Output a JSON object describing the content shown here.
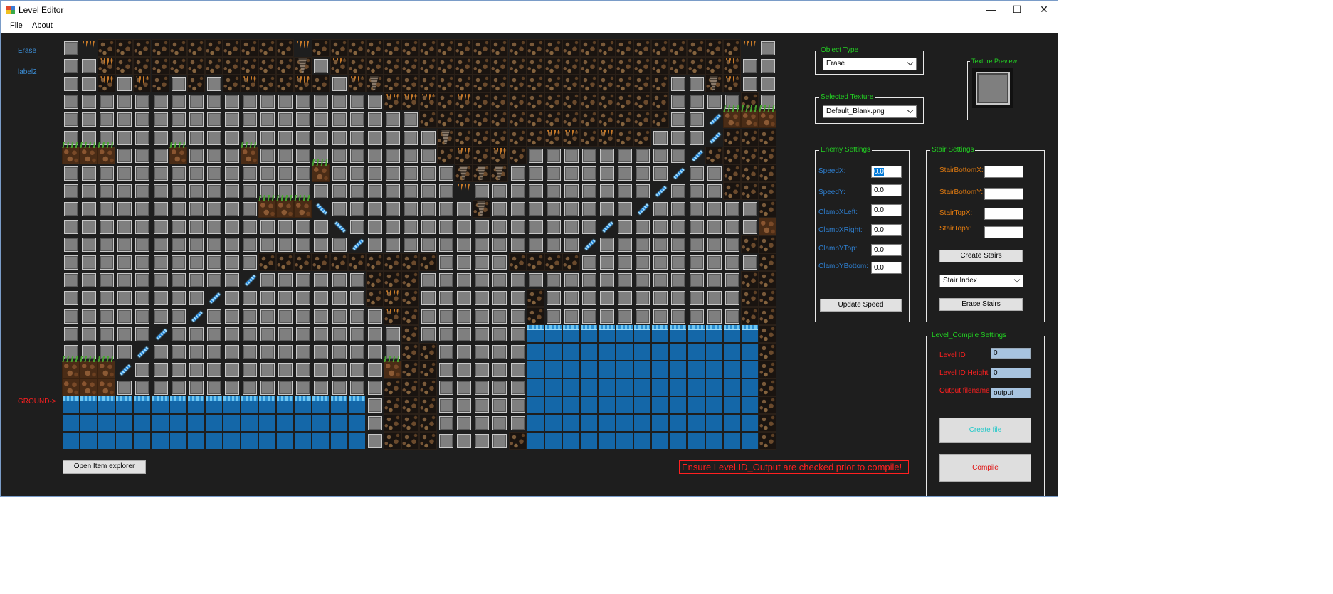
{
  "window": {
    "title": "Level Editor",
    "controls": {
      "minimize": "—",
      "maximize": "☐",
      "close": "✕"
    }
  },
  "menu": {
    "file": "File",
    "about": "About"
  },
  "side": {
    "erase": "Erase",
    "label2": "label2",
    "ground": "GROUND->"
  },
  "grid": {
    "cols": 40,
    "rows": 23,
    "legend": {
      "g": "blank-gray",
      "r": "rock",
      "s": "rock-stalactite",
      "t": "rock-tornado",
      "v": "stalactite",
      "d": "dirt",
      "D": "dirt-grass",
      "w": "water",
      "W": "water-top",
      "u": "stair-up",
      "n": "stair-down",
      ".": "empty"
    },
    "map": [
      "gvrrrrrrrrrrrvrrrrrrrrrrrrrrrrrrrrrrrrvg",
      "ggsrrrrrrrrrrtgsrrrrrrrrrrrrrrrrrrrrrsgg",
      "ggsgsrgrgrsrrsrgstrrrrrrrrrrrrrrrrggtsgg",
      "ggggggggggggggggggsssrsrrrrrrrrrrrggggrg",
      "ggggggggggggggggggggrrrrrrrrrrrrrrggnDDD",
      "gggggggggggggggggggggtrrrrrssrsrrgggnrrr",
      "DDDgggDgggDggggggggggrsrsrgggggggggnrrrr",
      "ggggggggggggggDgggggggtttgggggggggnggrrr",
      "ggggggggggggggggggggggvggggggggggngggrrr",
      "gggggggggggDDDuggggggggtggggggggnggggggr",
      "ggggggggggggggguggggggggggggggnggggggggd",
      "ggggggggggggggggnggggggggggggnggggggggrr",
      "gggggggggggrrrrrrrrrrggggrrrrggggggggggr",
      "ggggggggggnggggggrrrggggggggggggggggggrr",
      "ggggggggnggggggggrsrggggggrgggggggggggrr",
      "gggggggnggggggggggsrggggggrgggggggggggrr",
      "gggggngggggggggggggrggggggWWWWWWWWWWWWWr",
      "ggggnggggggggggggggrrgggggwwwwwwwwwwwwwr",
      "DDDnggggggggggggggDrrgggggwwwwwwwwwwwwwr",
      "dddgggggggggggggggrrrgggggwwwwwwwwwwwwwr",
      "WWWWWWWWWWWWWWWWWgrrrgggggwwwwwwwwwwwwwr",
      "wwwwwwwwwwwwwwwwwgrrrgggggwwwwwwwwwwwwwr",
      "wwwwwwwwwwwwwwwwwgrrrggggrwwwwwwwwwwwwwr"
    ]
  },
  "open_item_explorer": "Open Item explorer",
  "object_type": {
    "title": "Object Type",
    "value": "Erase"
  },
  "selected_texture": {
    "title": "Selected Texture",
    "value": "Default_Blank.png"
  },
  "texture_preview": {
    "title": "Texture Preview"
  },
  "enemy": {
    "title": "Enemy Settings",
    "fields": [
      {
        "label": "SpeedX:",
        "value": "0.0"
      },
      {
        "label": "SpeedY:",
        "value": "0.0"
      },
      {
        "label": "ClampXLeft:",
        "value": "0.0"
      },
      {
        "label": "ClampXRight:",
        "value": "0.0"
      },
      {
        "label": "ClampYTop:",
        "value": "0.0"
      },
      {
        "label": "ClampYBottom:",
        "value": "0.0"
      }
    ],
    "update_button": "Update Speed"
  },
  "stair": {
    "title": "Stair Settings",
    "fields": [
      {
        "label": "StairBottomX:",
        "value": ""
      },
      {
        "label": "StairBottomY:",
        "value": ""
      },
      {
        "label": "StairTopX:",
        "value": ""
      },
      {
        "label": "StairTopY:",
        "value": ""
      }
    ],
    "create_button": "Create Stairs",
    "index_select": "Stair Index",
    "erase_button": "Erase Stairs"
  },
  "compile": {
    "title": "Level_Compile Settings",
    "fields": [
      {
        "label": "Level ID",
        "value": "0"
      },
      {
        "label": "Level ID Height",
        "value": "0"
      },
      {
        "label": "Output filename",
        "value": "output"
      }
    ],
    "create_file_button": "Create file",
    "compile_button": "Compile",
    "create_file_color": "#22c8c8",
    "compile_color": "#e01010"
  },
  "warning": "Ensure Level ID_Output are checked prior to compile!"
}
